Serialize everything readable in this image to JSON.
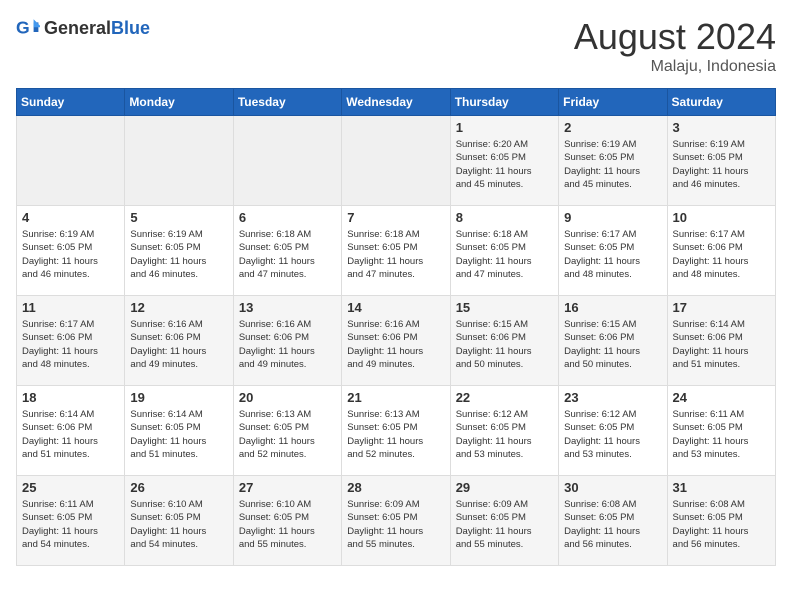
{
  "header": {
    "logo_general": "General",
    "logo_blue": "Blue",
    "month": "August 2024",
    "location": "Malaju, Indonesia"
  },
  "weekdays": [
    "Sunday",
    "Monday",
    "Tuesday",
    "Wednesday",
    "Thursday",
    "Friday",
    "Saturday"
  ],
  "weeks": [
    [
      {
        "day": "",
        "info": ""
      },
      {
        "day": "",
        "info": ""
      },
      {
        "day": "",
        "info": ""
      },
      {
        "day": "",
        "info": ""
      },
      {
        "day": "1",
        "info": "Sunrise: 6:20 AM\nSunset: 6:05 PM\nDaylight: 11 hours\nand 45 minutes."
      },
      {
        "day": "2",
        "info": "Sunrise: 6:19 AM\nSunset: 6:05 PM\nDaylight: 11 hours\nand 45 minutes."
      },
      {
        "day": "3",
        "info": "Sunrise: 6:19 AM\nSunset: 6:05 PM\nDaylight: 11 hours\nand 46 minutes."
      }
    ],
    [
      {
        "day": "4",
        "info": "Sunrise: 6:19 AM\nSunset: 6:05 PM\nDaylight: 11 hours\nand 46 minutes."
      },
      {
        "day": "5",
        "info": "Sunrise: 6:19 AM\nSunset: 6:05 PM\nDaylight: 11 hours\nand 46 minutes."
      },
      {
        "day": "6",
        "info": "Sunrise: 6:18 AM\nSunset: 6:05 PM\nDaylight: 11 hours\nand 47 minutes."
      },
      {
        "day": "7",
        "info": "Sunrise: 6:18 AM\nSunset: 6:05 PM\nDaylight: 11 hours\nand 47 minutes."
      },
      {
        "day": "8",
        "info": "Sunrise: 6:18 AM\nSunset: 6:05 PM\nDaylight: 11 hours\nand 47 minutes."
      },
      {
        "day": "9",
        "info": "Sunrise: 6:17 AM\nSunset: 6:05 PM\nDaylight: 11 hours\nand 48 minutes."
      },
      {
        "day": "10",
        "info": "Sunrise: 6:17 AM\nSunset: 6:06 PM\nDaylight: 11 hours\nand 48 minutes."
      }
    ],
    [
      {
        "day": "11",
        "info": "Sunrise: 6:17 AM\nSunset: 6:06 PM\nDaylight: 11 hours\nand 48 minutes."
      },
      {
        "day": "12",
        "info": "Sunrise: 6:16 AM\nSunset: 6:06 PM\nDaylight: 11 hours\nand 49 minutes."
      },
      {
        "day": "13",
        "info": "Sunrise: 6:16 AM\nSunset: 6:06 PM\nDaylight: 11 hours\nand 49 minutes."
      },
      {
        "day": "14",
        "info": "Sunrise: 6:16 AM\nSunset: 6:06 PM\nDaylight: 11 hours\nand 49 minutes."
      },
      {
        "day": "15",
        "info": "Sunrise: 6:15 AM\nSunset: 6:06 PM\nDaylight: 11 hours\nand 50 minutes."
      },
      {
        "day": "16",
        "info": "Sunrise: 6:15 AM\nSunset: 6:06 PM\nDaylight: 11 hours\nand 50 minutes."
      },
      {
        "day": "17",
        "info": "Sunrise: 6:14 AM\nSunset: 6:06 PM\nDaylight: 11 hours\nand 51 minutes."
      }
    ],
    [
      {
        "day": "18",
        "info": "Sunrise: 6:14 AM\nSunset: 6:06 PM\nDaylight: 11 hours\nand 51 minutes."
      },
      {
        "day": "19",
        "info": "Sunrise: 6:14 AM\nSunset: 6:05 PM\nDaylight: 11 hours\nand 51 minutes."
      },
      {
        "day": "20",
        "info": "Sunrise: 6:13 AM\nSunset: 6:05 PM\nDaylight: 11 hours\nand 52 minutes."
      },
      {
        "day": "21",
        "info": "Sunrise: 6:13 AM\nSunset: 6:05 PM\nDaylight: 11 hours\nand 52 minutes."
      },
      {
        "day": "22",
        "info": "Sunrise: 6:12 AM\nSunset: 6:05 PM\nDaylight: 11 hours\nand 53 minutes."
      },
      {
        "day": "23",
        "info": "Sunrise: 6:12 AM\nSunset: 6:05 PM\nDaylight: 11 hours\nand 53 minutes."
      },
      {
        "day": "24",
        "info": "Sunrise: 6:11 AM\nSunset: 6:05 PM\nDaylight: 11 hours\nand 53 minutes."
      }
    ],
    [
      {
        "day": "25",
        "info": "Sunrise: 6:11 AM\nSunset: 6:05 PM\nDaylight: 11 hours\nand 54 minutes."
      },
      {
        "day": "26",
        "info": "Sunrise: 6:10 AM\nSunset: 6:05 PM\nDaylight: 11 hours\nand 54 minutes."
      },
      {
        "day": "27",
        "info": "Sunrise: 6:10 AM\nSunset: 6:05 PM\nDaylight: 11 hours\nand 55 minutes."
      },
      {
        "day": "28",
        "info": "Sunrise: 6:09 AM\nSunset: 6:05 PM\nDaylight: 11 hours\nand 55 minutes."
      },
      {
        "day": "29",
        "info": "Sunrise: 6:09 AM\nSunset: 6:05 PM\nDaylight: 11 hours\nand 55 minutes."
      },
      {
        "day": "30",
        "info": "Sunrise: 6:08 AM\nSunset: 6:05 PM\nDaylight: 11 hours\nand 56 minutes."
      },
      {
        "day": "31",
        "info": "Sunrise: 6:08 AM\nSunset: 6:05 PM\nDaylight: 11 hours\nand 56 minutes."
      }
    ]
  ]
}
